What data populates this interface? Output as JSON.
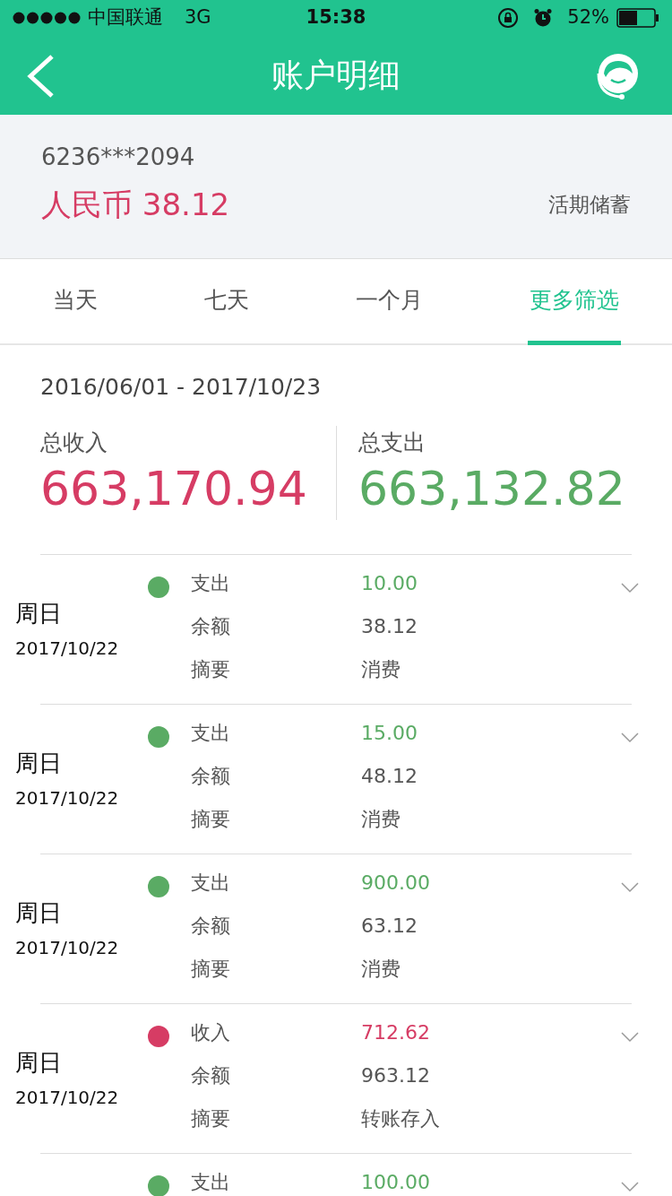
{
  "status_bar": {
    "carrier": "中国联通",
    "network": "3G",
    "time": "15:38",
    "battery_text": "52%"
  },
  "header": {
    "title": "账户明细"
  },
  "account": {
    "number": "6236***2094",
    "balance": "人民币 38.12",
    "type": "活期储蓄"
  },
  "tabs": [
    {
      "label": "当天",
      "selected": false
    },
    {
      "label": "七天",
      "selected": false
    },
    {
      "label": "一个月",
      "selected": false
    },
    {
      "label": "更多筛选",
      "selected": true
    }
  ],
  "summary": {
    "date_range": "2016/06/01 - 2017/10/23",
    "income_label": "总收入",
    "income": "663,170.94",
    "expense_label": "总支出",
    "expense": "663,132.82"
  },
  "transactions": [
    {
      "kind": "expense",
      "color": "#5aab64",
      "weekday": "周日",
      "date": "2017/10/22",
      "rows": [
        {
          "label": "支出",
          "value": "10.00"
        },
        {
          "label": "余额",
          "value": "38.12"
        },
        {
          "label": "摘要",
          "value": "消费"
        }
      ]
    },
    {
      "kind": "expense",
      "color": "#5aab64",
      "weekday": "周日",
      "date": "2017/10/22",
      "rows": [
        {
          "label": "支出",
          "value": "15.00"
        },
        {
          "label": "余额",
          "value": "48.12"
        },
        {
          "label": "摘要",
          "value": "消费"
        }
      ]
    },
    {
      "kind": "expense",
      "color": "#5aab64",
      "weekday": "周日",
      "date": "2017/10/22",
      "rows": [
        {
          "label": "支出",
          "value": "900.00"
        },
        {
          "label": "余额",
          "value": "63.12"
        },
        {
          "label": "摘要",
          "value": "消费"
        }
      ]
    },
    {
      "kind": "income",
      "color": "#d63c64",
      "weekday": "周日",
      "date": "2017/10/22",
      "rows": [
        {
          "label": "收入",
          "value": "712.62"
        },
        {
          "label": "余额",
          "value": "963.12"
        },
        {
          "label": "摘要",
          "value": "转账存入"
        }
      ]
    },
    {
      "kind": "expense",
      "color": "#5aab64",
      "rows": [
        {
          "label": "支出",
          "value": "100.00"
        }
      ]
    }
  ]
}
